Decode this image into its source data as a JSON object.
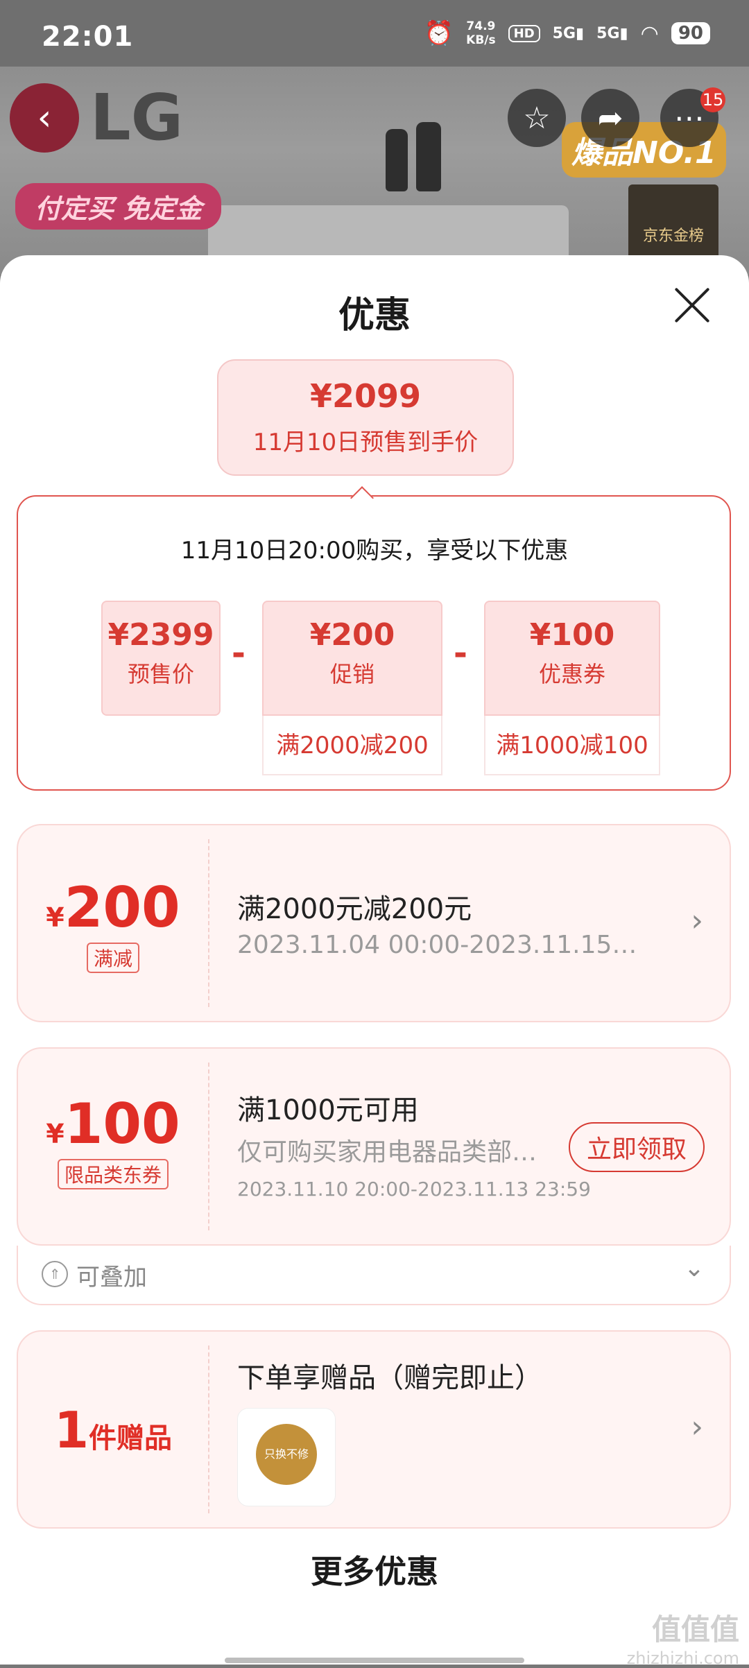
{
  "status_bar": {
    "time": "22:01",
    "net_speed_value": "74.9",
    "net_speed_unit": "KB/s",
    "hd": "HD",
    "signal1": "5G",
    "signal2": "5G",
    "battery": "90"
  },
  "background": {
    "brand": "LG",
    "promo": "付定买 免定金",
    "award": "爆品NO.1",
    "gold_list": "京东金榜",
    "cart_badge": "15"
  },
  "sheet": {
    "title": "优惠",
    "final_price": "¥2099",
    "final_price_label": "11月10日预售到手价",
    "breakdown_heading": "11月10日20:00购买，享受以下优惠",
    "items": [
      {
        "value": "¥2399",
        "label": "预售价",
        "sub": ""
      },
      {
        "value": "¥200",
        "label": "促销",
        "sub": "满2000减200"
      },
      {
        "value": "¥100",
        "label": "优惠券",
        "sub": "满1000减100"
      }
    ],
    "minus": "-"
  },
  "coupons": [
    {
      "currency": "¥",
      "amount": "200",
      "tag": "满减",
      "title": "满2000元减200元",
      "subtitle": "2023.11.04 00:00-2023.11.15…"
    },
    {
      "currency": "¥",
      "amount": "100",
      "tag": "限品类东券",
      "title": "满1000元可用",
      "subtitle": "仅可购买家用电器品类部…",
      "date": "2023.11.10 20:00-2023.11.13 23:59",
      "action": "立即领取",
      "stack_label": "可叠加"
    },
    {
      "count": "1",
      "unit": "件赠品",
      "title": "下单享赠品（赠完即止）",
      "gift_image_text": "只换不修"
    }
  ],
  "more_title": "更多优惠",
  "watermark": {
    "logo": "值值值",
    "url": "zhizhizhi.com"
  }
}
